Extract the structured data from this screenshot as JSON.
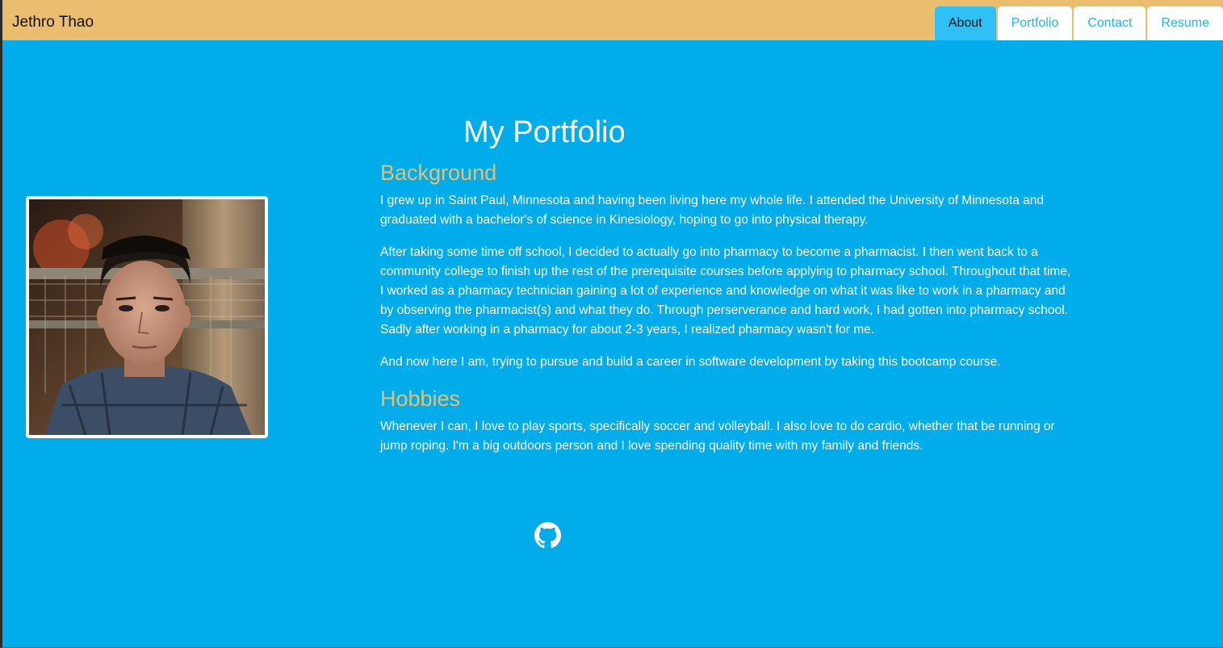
{
  "header": {
    "brand": "Jethro Thao",
    "tabs": [
      {
        "label": "About",
        "active": true
      },
      {
        "label": "Portfolio",
        "active": false
      },
      {
        "label": "Contact",
        "active": false
      },
      {
        "label": "Resume",
        "active": false
      }
    ]
  },
  "main": {
    "title": "My Portfolio",
    "background_heading": "Background",
    "background_paragraphs": [
      "I grew up in Saint Paul, Minnesota and having been living here my whole life. I attended the University of Minnesota and graduated with a bachelor's of science in Kinesiology, hoping to go into physical therapy.",
      "After taking some time off school, I decided to actually go into pharmacy to become a pharmacist. I then went back to a community college to finish up the rest of the prerequisite courses before applying to pharmacy school. Throughout that time, I worked as a pharmacy technician gaining a lot of experience and knowledge on what it was like to work in a pharmacy and by observing the pharmacist(s) and what they do. Through perserverance and hard work, I had gotten into pharmacy school. Sadly after working in a pharmacy for about 2-3 years, I realized pharmacy wasn't for me.",
      "And now here I am, trying to pursue and build a career in software development by taking this bootcamp course."
    ],
    "hobbies_heading": "Hobbies",
    "hobbies_paragraph": "Whenever I can, I love to play sports, specifically soccer and volleyball. I also love to do cardio, whether that be running or jump roping. I'm a big outdoors person and I love spending quality time with my family and friends."
  },
  "footer": {
    "icon": "github-icon"
  },
  "colors": {
    "page_background": "#00acea",
    "navbar_background": "#ebbd6e",
    "heading_accent": "#ebbd6e",
    "active_tab": "#2fc0f5",
    "tab_text": "#26b3e8"
  }
}
